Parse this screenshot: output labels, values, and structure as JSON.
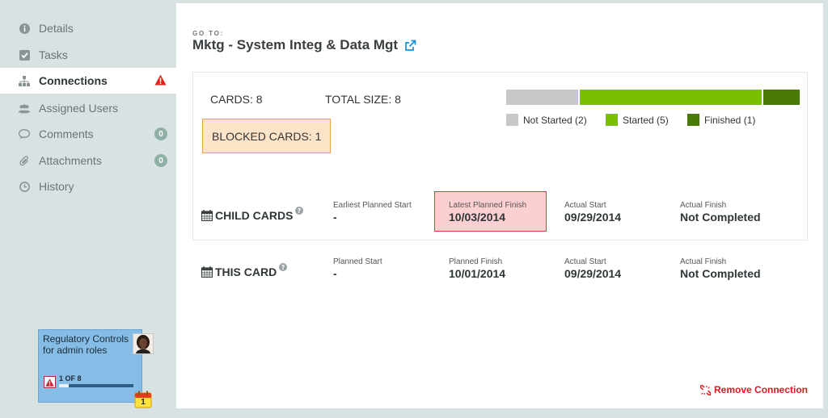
{
  "sidebar": {
    "items": [
      {
        "label": "Details",
        "icon": "info-icon"
      },
      {
        "label": "Tasks",
        "icon": "checkbox-icon"
      },
      {
        "label": "Connections",
        "icon": "hierarchy-icon",
        "active": true,
        "warning": true
      },
      {
        "label": "Assigned Users",
        "icon": "users-icon"
      },
      {
        "label": "Comments",
        "icon": "comments-icon",
        "badge": "0"
      },
      {
        "label": "Attachments",
        "icon": "paperclip-icon",
        "badge": "0"
      },
      {
        "label": "History",
        "icon": "clock-icon"
      }
    ]
  },
  "card": {
    "title": "Regulatory Controls for admin roles",
    "progress_text": "1 OF 8",
    "progress_fraction": 0.125,
    "calendar_number": "1",
    "color": "#86bde6"
  },
  "header": {
    "goto_label": "GO TO:",
    "title": "Mktg - System Integ & Data Mgt"
  },
  "stats": {
    "cards": "CARDS: 8",
    "total_size": "TOTAL SIZE: 8",
    "blocked": "BLOCKED CARDS: 1",
    "distribution": [
      {
        "label": "Not Started (2)",
        "count": 2,
        "color": "#c8c8c8"
      },
      {
        "label": "Started (5)",
        "count": 5,
        "color": "#7ac000"
      },
      {
        "label": "Finished (1)",
        "count": 1,
        "color": "#4a7a06"
      }
    ]
  },
  "child_cards": {
    "label": "CHILD CARDS",
    "columns": [
      {
        "label": "Earliest Planned Start",
        "value": "-"
      },
      {
        "label": "Latest Planned Finish",
        "value": "10/03/2014",
        "highlight": true
      },
      {
        "label": "Actual Start",
        "value": "09/29/2014"
      },
      {
        "label": "Actual Finish",
        "value": "Not Completed"
      }
    ]
  },
  "this_card": {
    "label": "THIS CARD",
    "columns": [
      {
        "label": "Planned Start",
        "value": "-"
      },
      {
        "label": "Planned Finish",
        "value": "10/01/2014"
      },
      {
        "label": "Actual Start",
        "value": "09/29/2014"
      },
      {
        "label": "Actual Finish",
        "value": "Not Completed"
      }
    ]
  },
  "actions": {
    "remove_connection": "Remove Connection"
  },
  "colors": {
    "accent_link": "#1a8fd6",
    "warning": "#e0231f",
    "remove": "#d8191f"
  }
}
